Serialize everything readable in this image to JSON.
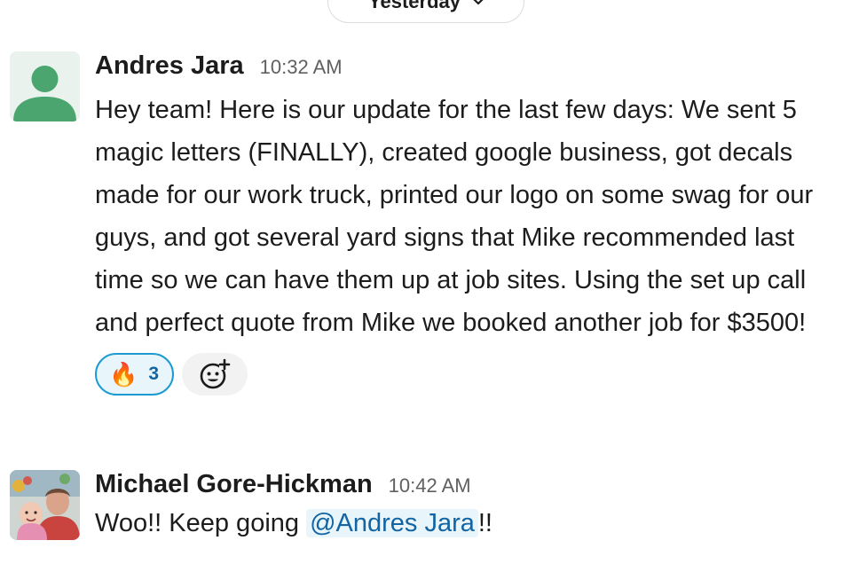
{
  "date_divider": {
    "label": "Yesterday"
  },
  "messages": [
    {
      "author": "Andres Jara",
      "time": "10:32 AM",
      "text": "Hey team! Here is our update for the last few days: We sent 5 magic letters (FINALLY), created google business, got decals made for our work truck, printed our logo on some swag for our guys, and got several yard signs that Mike recommended last time so we can have them up at job sites. Using the set up call and perfect quote from Mike we booked another job for $3500!",
      "avatar_icon": "default-user-icon",
      "reactions": [
        {
          "emoji": "🔥",
          "icon": "fire-emoji",
          "count": "3"
        }
      ],
      "add_reaction_icon": "add-emoji-icon"
    },
    {
      "author": "Michael Gore-Hickman",
      "time": "10:42 AM",
      "text_before": "Woo!! Keep going ",
      "mention": "@Andres Jara",
      "text_after": "!!",
      "avatar_icon": "user-photo"
    }
  ],
  "colors": {
    "accent": "#1264a3",
    "reaction_border": "#1d9bd1",
    "reaction_bg": "#e8f5fa",
    "avatar_default": "#4aa56f",
    "timestamp": "#616061"
  }
}
